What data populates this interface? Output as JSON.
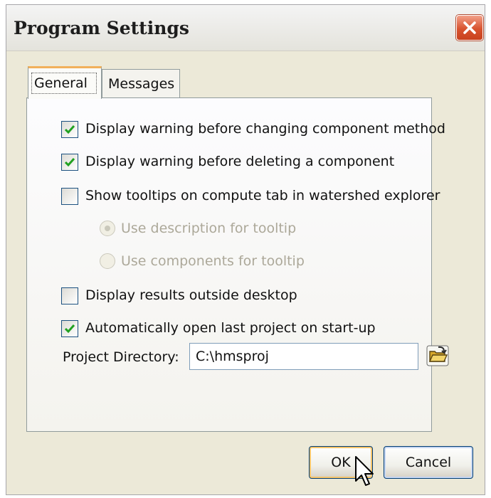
{
  "window": {
    "title": "Program Settings"
  },
  "tabs": [
    {
      "label": "General",
      "active": true
    },
    {
      "label": "Messages",
      "active": false
    }
  ],
  "general": {
    "options": [
      {
        "label": "Display warning before changing component method",
        "checked": true
      },
      {
        "label": "Display warning before deleting a component",
        "checked": true
      },
      {
        "label": "Show tooltips on compute tab in watershed explorer",
        "checked": false
      }
    ],
    "tooltip_options": [
      {
        "label": "Use description for tooltip",
        "selected": true,
        "enabled": false
      },
      {
        "label": "Use components for tooltip",
        "selected": false,
        "enabled": false
      }
    ],
    "more_options": [
      {
        "label": "Display results outside desktop",
        "checked": false
      },
      {
        "label": "Automatically open last project on start-up",
        "checked": true
      }
    ],
    "project_directory": {
      "label": "Project Directory:",
      "value": "C:\\hmsproj"
    }
  },
  "buttons": {
    "ok": "OK",
    "cancel": "Cancel"
  },
  "icons": {
    "close": "close-icon",
    "folder": "open-folder-icon",
    "cursor": "mouse-pointer-icon"
  }
}
